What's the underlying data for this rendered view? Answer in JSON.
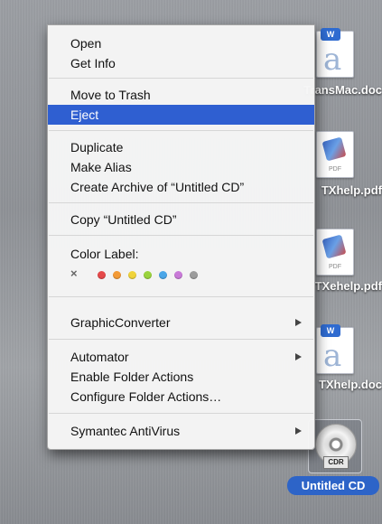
{
  "desktop": {
    "files": [
      {
        "label": "TransMac.doc",
        "kind": "doc"
      },
      {
        "label": "TXhelp.pdf",
        "kind": "pdf",
        "badge": "PDF"
      },
      {
        "label": "TXehelp.pdf",
        "kind": "pdf",
        "badge": "PDF"
      },
      {
        "label": "TXhelp.doc",
        "kind": "doc"
      }
    ],
    "cd": {
      "label": "Untitled CD",
      "badge": "CDR"
    }
  },
  "context_menu": {
    "open": "Open",
    "get_info": "Get Info",
    "move_to_trash": "Move to Trash",
    "eject": "Eject",
    "duplicate": "Duplicate",
    "make_alias": "Make Alias",
    "create_archive": "Create Archive of “Untitled CD”",
    "copy": "Copy “Untitled CD”",
    "color_label": "Color Label:",
    "color_none": "×",
    "colors": [
      "#e5494a",
      "#f39a36",
      "#f0d33a",
      "#9ad33d",
      "#4aa6e8",
      "#c97ad8",
      "#9c9c9c"
    ],
    "graphicconverter": "GraphicConverter",
    "automator": "Automator",
    "enable_folder_actions": "Enable Folder Actions",
    "configure_folder_actions": "Configure Folder Actions…",
    "symantec": "Symantec AntiVirus",
    "highlighted_item": "Eject",
    "highlight_color": "#2f5fd1"
  }
}
